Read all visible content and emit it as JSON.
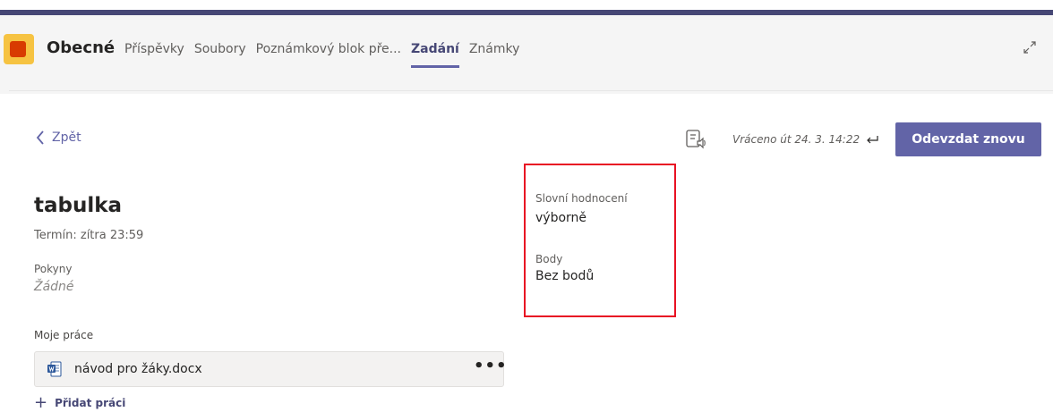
{
  "header": {
    "channel_name": "Obecné",
    "tabs": [
      {
        "label": "Příspěvky",
        "active": false
      },
      {
        "label": "Soubory",
        "active": false
      },
      {
        "label": "Poznámkový blok pře...",
        "active": false
      },
      {
        "label": "Zadání",
        "active": true
      },
      {
        "label": "Známky",
        "active": false
      }
    ]
  },
  "toolbar": {
    "back_label": "Zpět",
    "returned_text": "Vráceno út 24. 3. 14:22",
    "resubmit_label": "Odevzdat znovu"
  },
  "assignment": {
    "title": "tabulka",
    "due": "Termín: zítra 23:59",
    "instructions_label": "Pokyny",
    "instructions_value": "Žádné",
    "my_work_label": "Moje práce",
    "file_name": "návod pro žáky.docx",
    "file_more": "•••",
    "add_work_label": "Přidat práci"
  },
  "feedback": {
    "verbal_label": "Slovní hodnocení",
    "verbal_value": "výborně",
    "points_label": "Body",
    "points_value": "Bez bodů"
  },
  "colors": {
    "accent": "#6264a7",
    "top_bar": "#464775",
    "highlight_box": "#e81123"
  }
}
